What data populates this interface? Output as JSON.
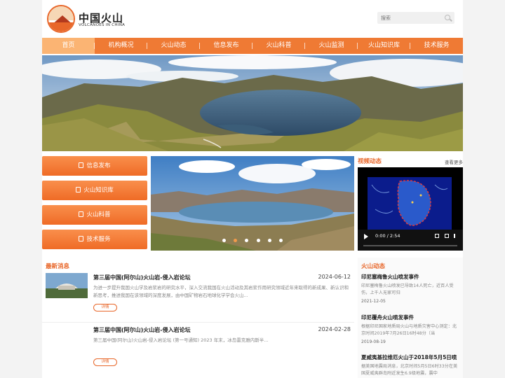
{
  "header": {
    "logo_cn": "中国火山",
    "logo_en": "VOLCANOES IN CHINA",
    "search_placeholder": "搜索"
  },
  "nav": {
    "items": [
      {
        "label": "首页"
      },
      {
        "label": "机构概况"
      },
      {
        "label": "火山动态"
      },
      {
        "label": "信息发布"
      },
      {
        "label": "火山科普"
      },
      {
        "label": "火山监测"
      },
      {
        "label": "火山知识库"
      },
      {
        "label": "技术服务"
      }
    ]
  },
  "sidebar": {
    "items": [
      {
        "label": "信息发布"
      },
      {
        "label": "火山知识库"
      },
      {
        "label": "火山科普"
      },
      {
        "label": "技术服务"
      }
    ]
  },
  "video": {
    "title": "视频动态",
    "more": "查看更多",
    "time": "0:00 / 2:54"
  },
  "news": {
    "title": "最新消息",
    "items": [
      {
        "title": "第三届中国(阿尔山)火山岩-侵入岩论坛",
        "date": "2024-06-12",
        "desc": "为进一步提升我国火山学及岩浆岩的研究水平，深入交流我国在火山活动及其岩浆作用研究领域近年来取得的新成果、新认识和新思考，推进我国在该领域的深度发展，由中国矿物岩石地球化学学会火山...",
        "btn": "详情"
      },
      {
        "title": "第三届中国(阿尔山)火山岩-侵入岩论坛",
        "date": "2024-02-28",
        "desc": "第三届中国(阿尔山)火山岩-侵入岩论坛 (第一号通知) 2023 年末，冰岛雷克雅内斯半...",
        "btn": "详情"
      }
    ]
  },
  "volcano_news": {
    "title": "火山动态",
    "items": [
      {
        "title": "印尼塞梅鲁火山喷发事件",
        "desc": "印尼塞梅鲁火山喷发已导致14人死亡，近百人受伤，上千人无家可归",
        "date": "2021-12-05"
      },
      {
        "title": "印尼覆舟火山喷发事件",
        "desc": "根据印尼国家地质局火山与地质灾害中心测定：北京时间2019年7月26日16时48分（当",
        "date": "2019-08-19"
      },
      {
        "title": "夏威夷基拉维厄火山于2018年5月5日喷",
        "desc": "据美国地震局消息，北京时间5月5日6时33分在美国夏威夷群岛附近发生6.9级地震，震中",
        "date": ""
      }
    ]
  }
}
